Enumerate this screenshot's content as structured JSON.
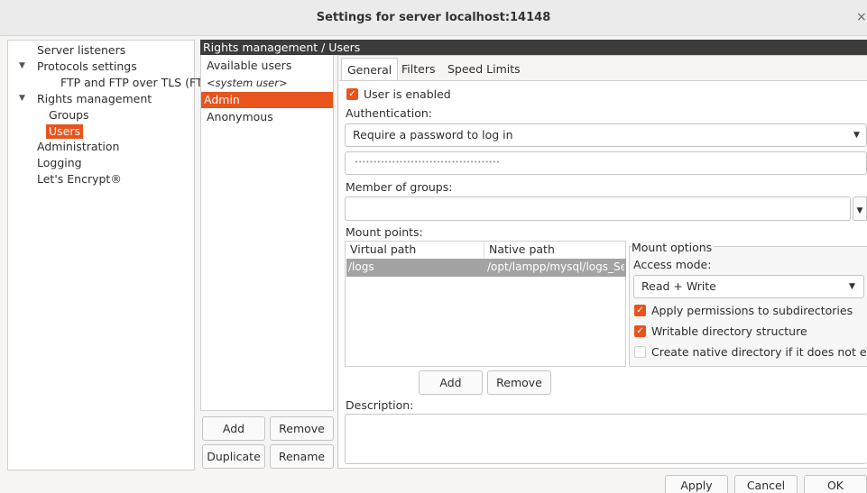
{
  "window": {
    "title": "Settings for server localhost:14148",
    "close_glyph": "×"
  },
  "tree": {
    "server_listeners": "Server listeners",
    "protocols_settings": "Protocols settings",
    "ftp_tls": "FTP and FTP over TLS (FTPS)",
    "rights_management": "Rights management",
    "groups": "Groups",
    "users": "Users",
    "administration": "Administration",
    "logging": "Logging",
    "lets_encrypt": "Let's Encrypt®"
  },
  "header": {
    "path": "Rights management / Users"
  },
  "users": {
    "heading": "Available users",
    "items": [
      "<system user>",
      "Admin",
      "Anonymous"
    ],
    "add": "Add",
    "remove": "Remove",
    "duplicate": "Duplicate",
    "rename": "Rename"
  },
  "tabs": [
    "General",
    "Filters",
    "Speed Limits"
  ],
  "general": {
    "user_enabled": "User is enabled",
    "authentication_label": "Authentication:",
    "authentication_value": "Require a password to log in",
    "password_mask": "••••••••••••••••••••••••••••••••••••••••",
    "member_of_groups_label": "Member of groups:",
    "mount_points_label": "Mount points:",
    "col_virtual": "Virtual path",
    "col_native": "Native path",
    "mount_virtual": "/logs",
    "mount_native": "/opt/lampp/mysql/logs_Se",
    "mount_options_label": "Mount options",
    "access_mode_label": "Access mode:",
    "access_mode_value": "Read + Write",
    "apply_permissions": "Apply permissions to subdirectories",
    "writable_structure": "Writable directory structure",
    "create_native": "Create native directory if it does not exist",
    "mount_add": "Add",
    "mount_remove": "Remove",
    "description_label": "Description:"
  },
  "footer": {
    "apply": "Apply",
    "cancel": "Cancel",
    "ok": "OK"
  },
  "colors": {
    "accent": "#e9541d",
    "header_bar": "#3c3c3c",
    "selected_row": "#a3a3a3"
  },
  "icons": {
    "expand": "▼",
    "dropdown": "▼",
    "check": "✓"
  }
}
